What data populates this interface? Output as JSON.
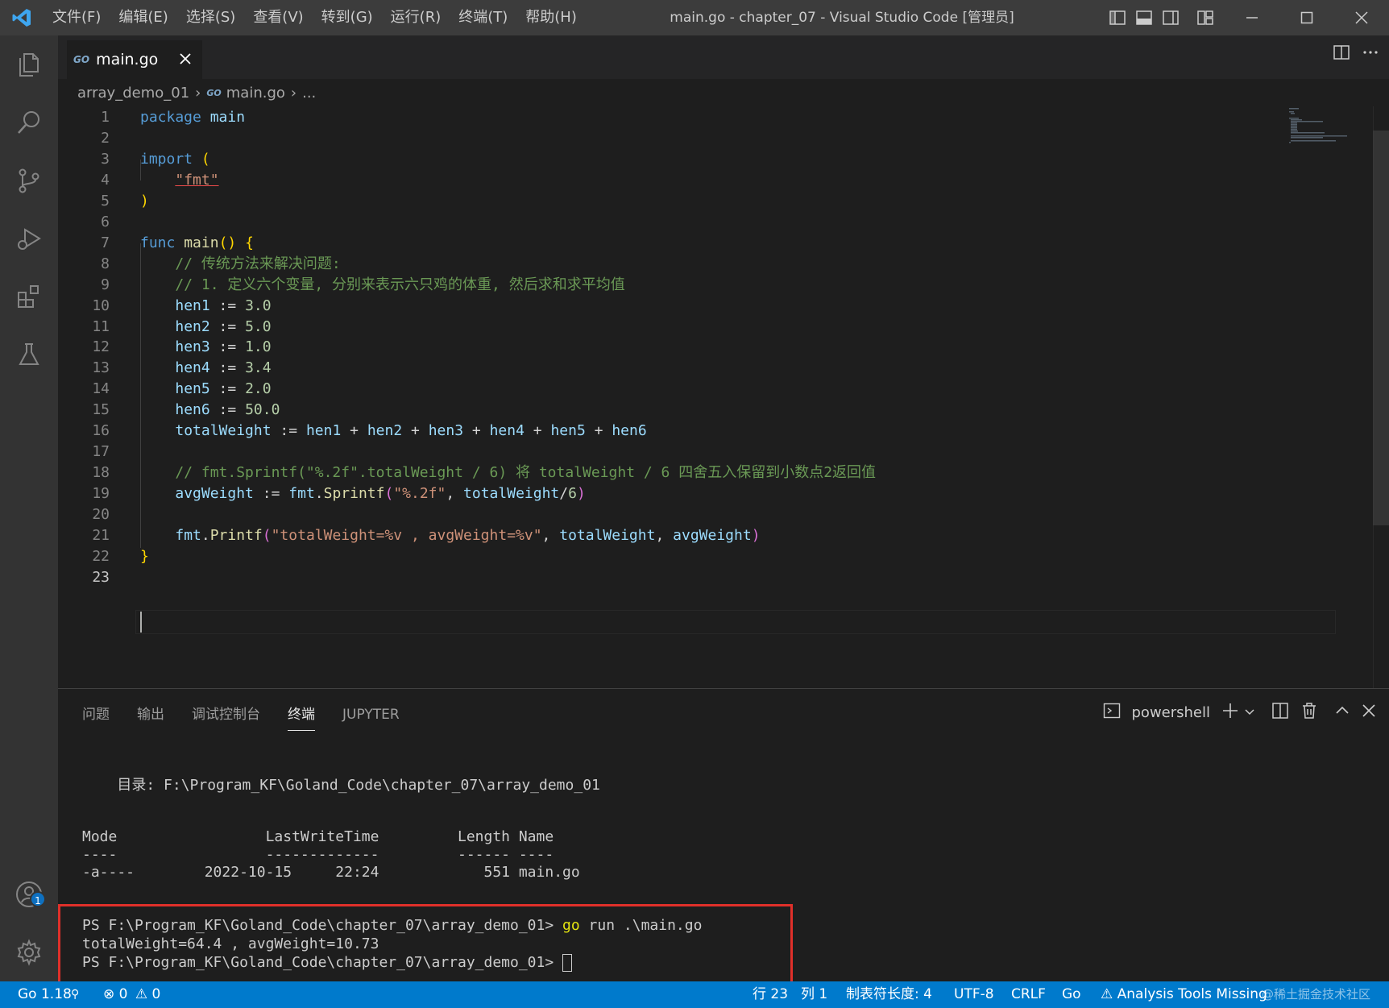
{
  "menu": [
    "文件(F)",
    "编辑(E)",
    "选择(S)",
    "查看(V)",
    "转到(G)",
    "运行(R)",
    "终端(T)",
    "帮助(H)"
  ],
  "window_title": "main.go - chapter_07 - Visual Studio Code [管理员]",
  "tab": {
    "icon_text": "GO",
    "label": "main.go"
  },
  "breadcrumb": {
    "folder": "array_demo_01",
    "file": "main.go",
    "more": "..."
  },
  "code_lines": [
    "package main",
    "",
    "import (",
    "    \"fmt\"",
    ")",
    "",
    "func main() {",
    "    // 传统方法来解决问题:",
    "    // 1. 定义六个变量, 分别来表示六只鸡的体重, 然后求和求平均值",
    "    hen1 := 3.0",
    "    hen2 := 5.0",
    "    hen3 := 1.0",
    "    hen4 := 3.4",
    "    hen5 := 2.0",
    "    hen6 := 50.0",
    "    totalWeight := hen1 + hen2 + hen3 + hen4 + hen5 + hen6",
    "",
    "    // fmt.Sprintf(\"%.2f\".totalWeight / 6) 将 totalWeight / 6 四舍五入保留到小数点2返回值",
    "    avgWeight := fmt.Sprintf(\"%.2f\", totalWeight/6)",
    "",
    "    fmt.Printf(\"totalWeight=%v , avgWeight=%v\", totalWeight, avgWeight)",
    "}",
    ""
  ],
  "line_numbers": [
    "1",
    "2",
    "3",
    "4",
    "5",
    "6",
    "7",
    "8",
    "9",
    "10",
    "11",
    "12",
    "13",
    "14",
    "15",
    "16",
    "17",
    "18",
    "19",
    "20",
    "21",
    "22",
    "23"
  ],
  "panel": {
    "tabs": [
      "问题",
      "输出",
      "调试控制台",
      "终端",
      "JUPYTER"
    ],
    "active_tab": "终端",
    "shell": "powershell"
  },
  "terminal": {
    "directory": "    目录: F:\\Program_KF\\Goland_Code\\chapter_07\\array_demo_01",
    "header": "Mode                 LastWriteTime         Length Name",
    "underline": "----                 -------------         ------ ----",
    "row": "-a----        2022-10-15     22:24            551 main.go",
    "prompt1": "PS F:\\Program_KF\\Goland_Code\\chapter_07\\array_demo_01> ",
    "cmd_go": "go",
    "cmd_rest": " run .\\main.go",
    "output": "totalWeight=64.4 , avgWeight=10.73",
    "prompt2": "PS F:\\Program_KF\\Goland_Code\\chapter_07\\array_demo_01> "
  },
  "statusbar": {
    "go_version": "Go 1.18",
    "errors": "0",
    "warnings": "0",
    "line": "行 23",
    "col": "列 1",
    "tab_size": "制表符长度: 4",
    "encoding": "UTF-8",
    "eol": "CRLF",
    "language": "Go",
    "analysis": "Analysis Tools Missing",
    "watermark": "@稀土掘金技术社区"
  },
  "account_badge": "1",
  "colors": {
    "accent": "#007acc",
    "highlight": "#e0302a"
  }
}
